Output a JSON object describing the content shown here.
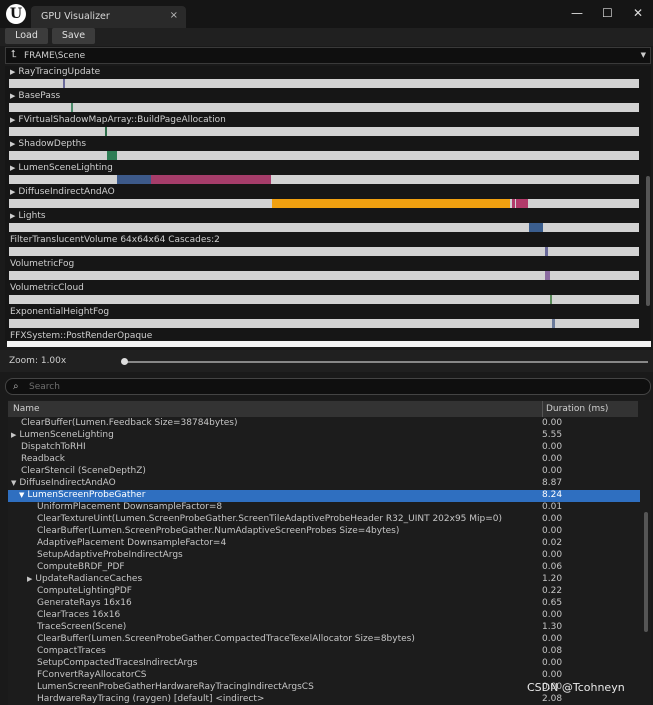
{
  "window": {
    "title": "GPU Visualizer",
    "close": "×",
    "minimize": "—",
    "maximize": "☐",
    "window_close": "✕"
  },
  "toolbar": {
    "load": "Load",
    "save": "Save"
  },
  "path": {
    "icon": "⮤",
    "text": "FRAME\\Scene",
    "dropdown": "▼"
  },
  "visualizer": {
    "rows": [
      {
        "label": "RayTracingUpdate",
        "expandable": true,
        "segments": [
          {
            "start": 0.086,
            "end": 0.089,
            "color": "#6a6a9a"
          }
        ]
      },
      {
        "label": "BasePass",
        "expandable": true,
        "segments": [
          {
            "start": 0.098,
            "end": 0.101,
            "color": "#4a8a6a"
          }
        ]
      },
      {
        "label": "FVirtualShadowMapArray::BuildPageAllocation",
        "expandable": true,
        "segments": [
          {
            "start": 0.152,
            "end": 0.156,
            "color": "#2e6e4a"
          }
        ]
      },
      {
        "label": "ShadowDepths",
        "expandable": true,
        "segments": [
          {
            "start": 0.155,
            "end": 0.171,
            "color": "#2e7d55"
          }
        ]
      },
      {
        "label": "LumenSceneLighting",
        "expandable": true,
        "segments": [
          {
            "start": 0.171,
            "end": 0.226,
            "color": "#3d5a8a"
          },
          {
            "start": 0.226,
            "end": 0.416,
            "color": "#a63d6a"
          }
        ]
      },
      {
        "label": "DiffuseIndirectAndAO",
        "expandable": true,
        "segments": [
          {
            "start": 0.418,
            "end": 0.795,
            "color": "#f0a010"
          },
          {
            "start": 0.798,
            "end": 0.803,
            "color": "#b23a6a"
          },
          {
            "start": 0.805,
            "end": 0.824,
            "color": "#b23a6a"
          }
        ]
      },
      {
        "label": "Lights",
        "expandable": true,
        "segments": [
          {
            "start": 0.825,
            "end": 0.848,
            "color": "#3b5e8e"
          }
        ]
      },
      {
        "label": "FilterTranslucentVolume 64x64x64 Cascades:2",
        "expandable": false,
        "segments": [
          {
            "start": 0.851,
            "end": 0.855,
            "color": "#6a6a9a"
          }
        ]
      },
      {
        "label": "VolumetricFog",
        "expandable": false,
        "segments": [
          {
            "start": 0.851,
            "end": 0.858,
            "color": "#8a6aa0"
          }
        ]
      },
      {
        "label": "VolumetricCloud",
        "expandable": false,
        "segments": [
          {
            "start": 0.859,
            "end": 0.862,
            "color": "#5a8a5a"
          }
        ]
      },
      {
        "label": "ExponentialHeightFog",
        "expandable": false,
        "segments": [
          {
            "start": 0.862,
            "end": 0.866,
            "color": "#6a7a9a"
          }
        ]
      },
      {
        "label": "FFXSystem::PostRenderOpaque",
        "expandable": false,
        "segments": [
          {
            "start": 0.866,
            "end": 0.869,
            "color": "#6a6a7a"
          }
        ]
      }
    ]
  },
  "zoom": {
    "label": "Zoom: 1.00x",
    "value": 0.0
  },
  "search": {
    "icon": "⌕",
    "placeholder": "Search"
  },
  "tree": {
    "col_name": "Name",
    "col_duration": "Duration (ms)",
    "rows": [
      {
        "name": "ClearBuffer(Lumen.Feedback Size=38784bytes)",
        "duration": "0.00",
        "indent": 0,
        "expandable": false,
        "expanded": false,
        "selected": false
      },
      {
        "name": "LumenSceneLighting",
        "duration": "5.55",
        "indent": 0,
        "expandable": true,
        "expanded": false,
        "selected": false
      },
      {
        "name": "DispatchToRHI",
        "duration": "0.00",
        "indent": 0,
        "expandable": false,
        "expanded": false,
        "selected": false
      },
      {
        "name": "Readback",
        "duration": "0.00",
        "indent": 0,
        "expandable": false,
        "expanded": false,
        "selected": false
      },
      {
        "name": "ClearStencil (SceneDepthZ)",
        "duration": "0.00",
        "indent": 0,
        "expandable": false,
        "expanded": false,
        "selected": false
      },
      {
        "name": "DiffuseIndirectAndAO",
        "duration": "8.87",
        "indent": 0,
        "expandable": true,
        "expanded": true,
        "selected": false
      },
      {
        "name": "LumenScreenProbeGather",
        "duration": "8.24",
        "indent": 1,
        "expandable": true,
        "expanded": true,
        "selected": true
      },
      {
        "name": "UniformPlacement DownsampleFactor=8",
        "duration": "0.01",
        "indent": 2,
        "expandable": false,
        "expanded": false,
        "selected": false
      },
      {
        "name": "ClearTextureUint(Lumen.ScreenProbeGather.ScreenTileAdaptiveProbeHeader R32_UINT 202x95 Mip=0)",
        "duration": "0.00",
        "indent": 2,
        "expandable": false,
        "expanded": false,
        "selected": false
      },
      {
        "name": "ClearBuffer(Lumen.ScreenProbeGather.NumAdaptiveScreenProbes Size=4bytes)",
        "duration": "0.00",
        "indent": 2,
        "expandable": false,
        "expanded": false,
        "selected": false
      },
      {
        "name": "AdaptivePlacement DownsampleFactor=4",
        "duration": "0.02",
        "indent": 2,
        "expandable": false,
        "expanded": false,
        "selected": false
      },
      {
        "name": "SetupAdaptiveProbeIndirectArgs",
        "duration": "0.00",
        "indent": 2,
        "expandable": false,
        "expanded": false,
        "selected": false
      },
      {
        "name": "ComputeBRDF_PDF",
        "duration": "0.06",
        "indent": 2,
        "expandable": false,
        "expanded": false,
        "selected": false
      },
      {
        "name": "UpdateRadianceCaches",
        "duration": "1.20",
        "indent": 2,
        "expandable": true,
        "expanded": false,
        "selected": false
      },
      {
        "name": "ComputeLightingPDF",
        "duration": "0.22",
        "indent": 2,
        "expandable": false,
        "expanded": false,
        "selected": false
      },
      {
        "name": "GenerateRays 16x16",
        "duration": "0.65",
        "indent": 2,
        "expandable": false,
        "expanded": false,
        "selected": false
      },
      {
        "name": "ClearTraces 16x16",
        "duration": "0.00",
        "indent": 2,
        "expandable": false,
        "expanded": false,
        "selected": false
      },
      {
        "name": "TraceScreen(Scene)",
        "duration": "1.30",
        "indent": 2,
        "expandable": false,
        "expanded": false,
        "selected": false
      },
      {
        "name": "ClearBuffer(Lumen.ScreenProbeGather.CompactedTraceTexelAllocator Size=8bytes)",
        "duration": "0.00",
        "indent": 2,
        "expandable": false,
        "expanded": false,
        "selected": false
      },
      {
        "name": "CompactTraces",
        "duration": "0.08",
        "indent": 2,
        "expandable": false,
        "expanded": false,
        "selected": false
      },
      {
        "name": "SetupCompactedTracesIndirectArgs",
        "duration": "0.00",
        "indent": 2,
        "expandable": false,
        "expanded": false,
        "selected": false
      },
      {
        "name": "FConvertRayAllocatorCS",
        "duration": "0.00",
        "indent": 2,
        "expandable": false,
        "expanded": false,
        "selected": false
      },
      {
        "name": "LumenScreenProbeGatherHardwareRayTracingIndirectArgsCS",
        "duration": "0.00",
        "indent": 2,
        "expandable": false,
        "expanded": false,
        "selected": false
      },
      {
        "name": "HardwareRayTracing (raygen) [default] <indirect>",
        "duration": "2.08",
        "indent": 2,
        "expandable": false,
        "expanded": false,
        "selected": false
      }
    ]
  },
  "watermark": "CSDN @Tcohneyn"
}
